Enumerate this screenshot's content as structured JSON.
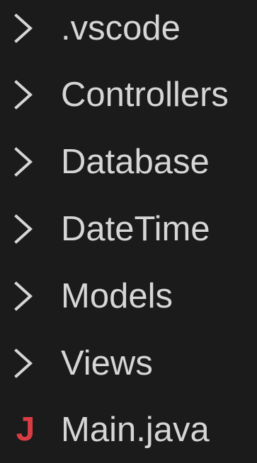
{
  "explorer": {
    "items": [
      {
        "label": ".vscode",
        "icon": "chevron-right-icon"
      },
      {
        "label": "Controllers",
        "icon": "chevron-right-icon"
      },
      {
        "label": "Database",
        "icon": "chevron-right-icon"
      },
      {
        "label": "DateTime",
        "icon": "chevron-right-icon"
      },
      {
        "label": "Models",
        "icon": "chevron-right-icon"
      },
      {
        "label": "Views",
        "icon": "chevron-right-icon"
      },
      {
        "label": "Main.java",
        "icon": "java-icon",
        "icon_text": "J"
      }
    ],
    "colors": {
      "background": "#1b1b1b",
      "text": "#d6d6d6",
      "chevron": "#d6d6d6",
      "java_icon": "#d83d43"
    }
  }
}
